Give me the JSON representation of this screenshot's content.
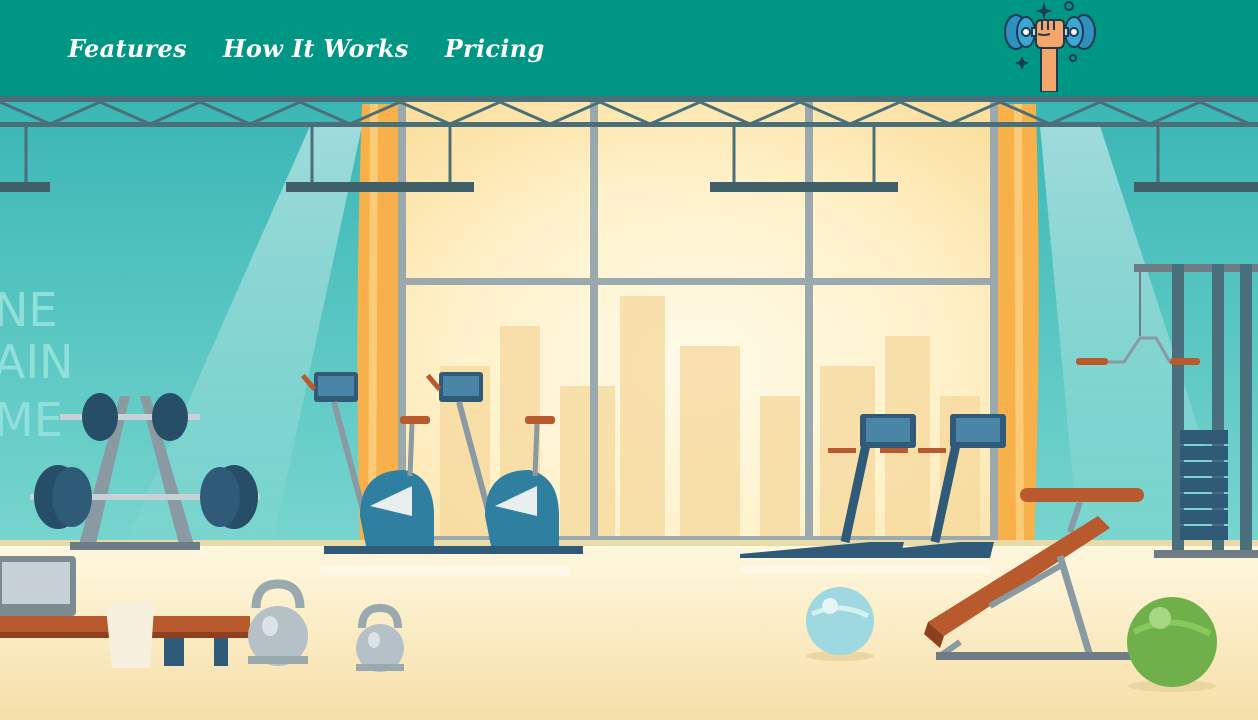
{
  "nav": {
    "links": [
      {
        "label": "Features"
      },
      {
        "label": "How It Works"
      },
      {
        "label": "Pricing"
      }
    ]
  },
  "logo": {
    "icon": "dumbbell-fist-icon"
  },
  "hero": {
    "wall_text": [
      "NE",
      "AIN",
      "ME"
    ]
  },
  "colors": {
    "nav_bg": "#009684",
    "nav_text": "#ffffff",
    "wall": "#5fc9c3",
    "floor": "#fbeec7",
    "window_glow": "#fff7dc",
    "curtain": "#f7b04a",
    "equipment_dark": "#2f5a78",
    "wood": "#b85a2d"
  }
}
